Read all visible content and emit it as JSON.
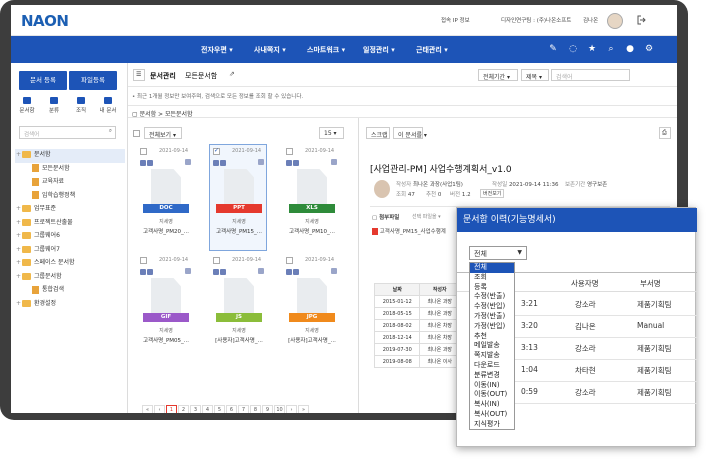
{
  "app": {
    "logo": "NAON",
    "meta": [
      "접속 IP 정보",
      "디자인연구팀 : (주)나온소프트",
      "김나온"
    ],
    "nav": [
      "전자우편",
      "사내쪽지",
      "스마트워크",
      "일정관리",
      "근태관리"
    ]
  },
  "sidebar": {
    "btn_register": "문서 등록",
    "btn_file": "파일등록",
    "quick": [
      "문서함",
      "분류",
      "조직",
      "내 문서"
    ],
    "search_placeholder": "검색어",
    "tree": [
      {
        "label": "문서함",
        "kind": "folder",
        "level": 0,
        "selected": true
      },
      {
        "label": "모든문서함",
        "kind": "doc",
        "level": 1
      },
      {
        "label": "교육자료",
        "kind": "doc",
        "level": 1
      },
      {
        "label": "임학습행정책",
        "kind": "doc",
        "level": 1
      },
      {
        "label": "업무표준",
        "kind": "folder",
        "level": 0
      },
      {
        "label": "프로젝트산출물",
        "kind": "folder",
        "level": 0
      },
      {
        "label": "그룹웨어6",
        "kind": "folder",
        "level": 0
      },
      {
        "label": "그룹웨어7",
        "kind": "folder",
        "level": 0
      },
      {
        "label": "스페이스 문서함",
        "kind": "folder",
        "level": 0
      },
      {
        "label": "그룹문서함",
        "kind": "folder",
        "level": 0
      },
      {
        "label": "통합검색",
        "kind": "doc",
        "level": 1
      },
      {
        "label": "환경설정",
        "kind": "folder",
        "level": 0
      }
    ]
  },
  "main": {
    "tab_manage": "문서관리",
    "tab_all": "모든문서함",
    "notice": "• 최근 1개월 정보만 보여주며, 검색으로 모든 정보를 조회 할 수 있습니다.",
    "filter_period": "전체기간",
    "filter_title": "제목",
    "search_placeholder": "검색어",
    "path": "문서함 > 모든문서함",
    "view_label": "전체보기",
    "page_size": "15",
    "scrap": "스크랩",
    "move": "이 문서를",
    "files": [
      {
        "date": "2021-09-14",
        "type": "DOC",
        "color": "#2f69c7",
        "owner": "지세영",
        "name": "고객사명_PM20_...",
        "selected": false
      },
      {
        "date": "2021-09-14",
        "type": "PPT",
        "color": "#e5392e",
        "owner": "지세영",
        "name": "고객사명_PM15_...",
        "selected": true
      },
      {
        "date": "2021-09-14",
        "type": "XLS",
        "color": "#2e8b3a",
        "owner": "지세영",
        "name": "고객사명_PM10_...",
        "selected": false
      },
      {
        "date": "2021-09-14",
        "type": "GIF",
        "color": "#9b59c9",
        "owner": "지세영",
        "name": "고객사명_PM05_...",
        "selected": false
      },
      {
        "date": "2021-09-14",
        "type": "JS",
        "color": "#8bbd3a",
        "owner": "지세영",
        "name": "[사용자]고객사명_...",
        "selected": false
      },
      {
        "date": "2021-09-14",
        "type": "JPG",
        "color": "#f08a1c",
        "owner": "지세영",
        "name": "[사용자]고객사명_...",
        "selected": false
      }
    ],
    "pages": [
      "«",
      "‹",
      "1",
      "2",
      "3",
      "4",
      "5",
      "6",
      "7",
      "8",
      "9",
      "10",
      "›",
      "»"
    ],
    "current_page": "1"
  },
  "detail": {
    "title": "[사업관리-PM] 사업수행계획서_v1.0",
    "author_label": "작성자",
    "author": "최나온 과장(사업1팀)",
    "created_label": "작성일",
    "created": "2021-09-14 11:36",
    "keep_label": "보존기간",
    "keep": "영구보존",
    "views_label": "조회",
    "views": "47",
    "recommend_label": "추천",
    "recommend": "0",
    "version_label": "버전",
    "version": "1.2",
    "version_btn": "버전보기",
    "attach_label": "첨부파일",
    "attach_select": "선택 파일을",
    "attach_file": "고객사명_PM15_사업수행계",
    "hist_headers": [
      "날짜",
      "작성자"
    ],
    "hist_rows": [
      [
        "2015-01-12",
        "최나온 과장"
      ],
      [
        "2018-05-15",
        "최나온 과장"
      ],
      [
        "2018-08-02",
        "최나온 차장"
      ],
      [
        "2018-12-14",
        "최나온 차장"
      ],
      [
        "2019-07-30",
        "최나온 과장"
      ],
      [
        "2019-08-08",
        "최나온 이사"
      ]
    ]
  },
  "popup": {
    "title": "문서함 이력(기능명세서)",
    "select_value": "전체",
    "options": [
      "전체",
      "조회",
      "등록",
      "수정(반출)",
      "수정(반입)",
      "가정(반출)",
      "가정(반입)",
      "추천",
      "메일발송",
      "쪽지발송",
      "다운로드",
      "분류변경",
      "이동(IN)",
      "이동(OUT)",
      "복사(IN)",
      "복사(OUT)",
      "지식평가"
    ],
    "col_user": "사용자명",
    "col_dept": "부서명",
    "rows": [
      {
        "time": "3:21",
        "user": "강소라",
        "dept": "제품기획팀"
      },
      {
        "time": "3:20",
        "user": "김나온",
        "dept": "Manual"
      },
      {
        "time": "3:13",
        "user": "강소라",
        "dept": "제품기획팀"
      },
      {
        "time": "1:04",
        "user": "차타현",
        "dept": "제품기획팀"
      },
      {
        "time": "0:59",
        "user": "강소라",
        "dept": "제품기획팀"
      }
    ]
  }
}
